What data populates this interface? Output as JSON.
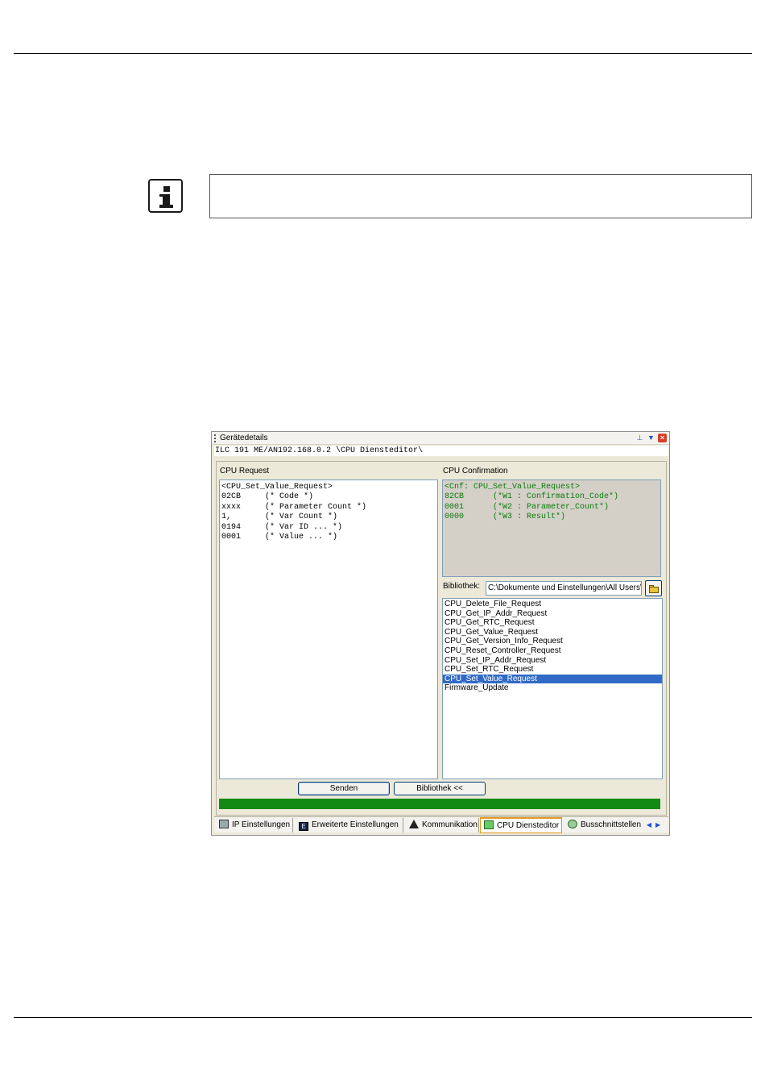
{
  "window": {
    "title": "Gerätedetails",
    "path": "ILC 191 ME/AN192.168.0.2 \\CPU Diensteditor\\"
  },
  "request": {
    "label": "CPU Request",
    "lines": [
      "<CPU_Set_Value_Request>",
      "02CB     (* Code *)",
      "xxxx     (* Parameter Count *)",
      "1,       (* Var Count *)",
      "0194     (* Var ID ... *)",
      "0001     (* Value ... *)"
    ]
  },
  "confirmation": {
    "label": "CPU Confirmation",
    "lines": [
      "<Cnf: CPU_Set_Value_Request>",
      "82CB      (*W1 : Confirmation_Code*)",
      "0001      (*W2 : Parameter_Count*)",
      "0000      (*W3 : Result*)"
    ]
  },
  "library": {
    "label": "Bibliothek:",
    "path": "C:\\Dokumente und Einstellungen\\All Users\\",
    "items": [
      "CPU_Delete_File_Request",
      "CPU_Get_IP_Addr_Request",
      "CPU_Get_RTC_Request",
      "CPU_Get_Value_Request",
      "CPU_Get_Version_Info_Request",
      "CPU_Reset_Controller_Request",
      "CPU_Set_IP_Addr_Request",
      "CPU_Set_RTC_Request",
      "CPU_Set_Value_Request",
      "Firmware_Update"
    ],
    "selected": "CPU_Set_Value_Request"
  },
  "buttons": {
    "send": "Senden",
    "library": "Bibliothek <<"
  },
  "progress": 1.0,
  "colors": {
    "progress": "#138a13",
    "selection": "#316ac5",
    "confirmation_text": "#0a7a0a"
  },
  "tabs": [
    {
      "label": "IP Einstellungen",
      "icon": "network-icon"
    },
    {
      "label": "Erweiterte Einstellungen",
      "icon": "extended-settings-icon"
    },
    {
      "label": "Kommunikation",
      "icon": "communication-icon"
    },
    {
      "label": "CPU Diensteditor",
      "icon": "cpu-service-icon"
    },
    {
      "label": "Busschnittstellen",
      "icon": "bus-interface-icon"
    }
  ]
}
